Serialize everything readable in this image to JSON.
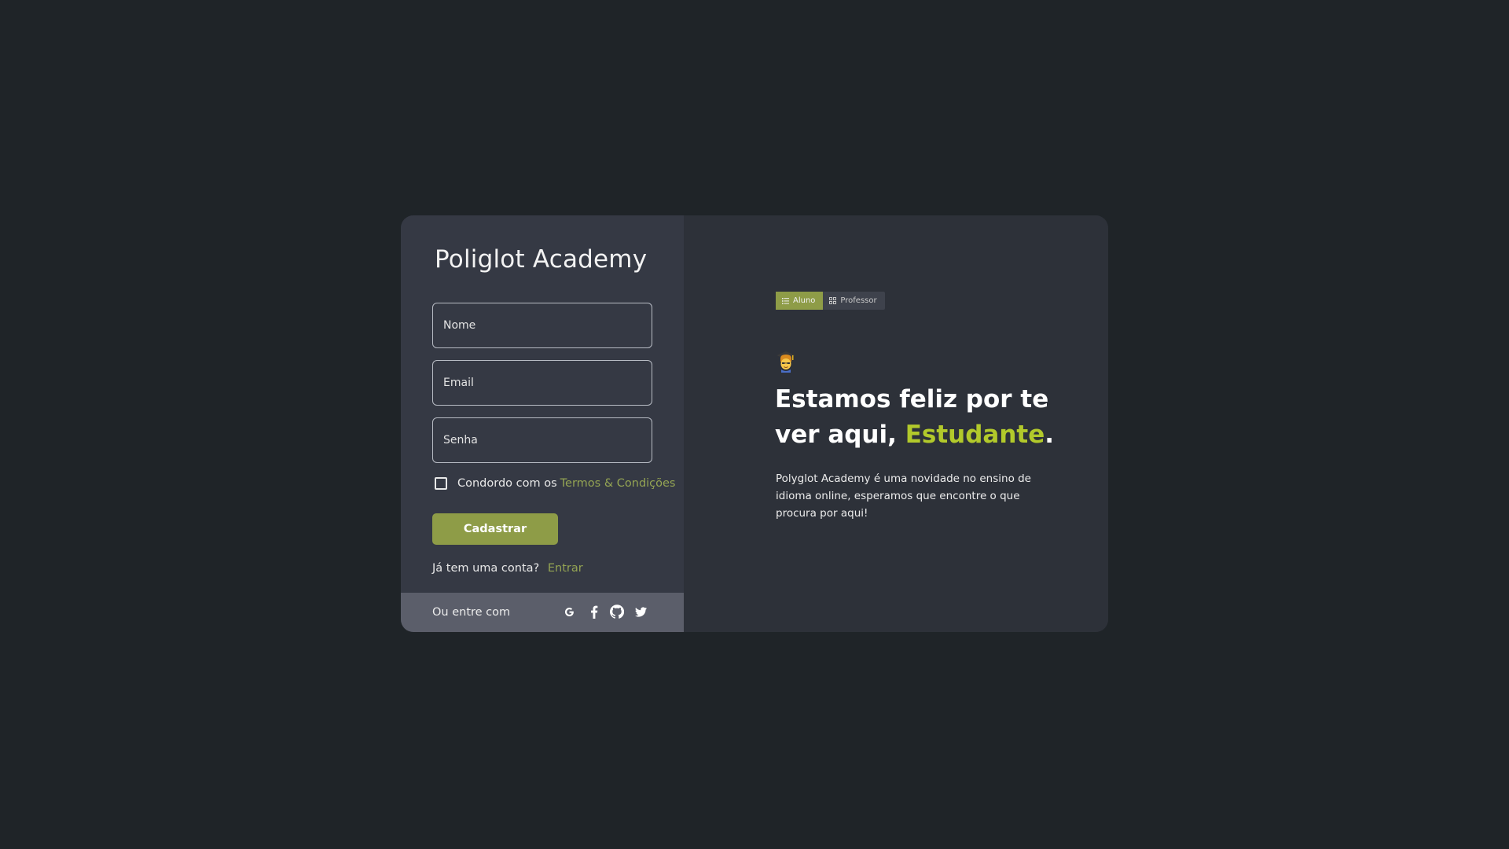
{
  "brand": {
    "title": "Poliglot Academy"
  },
  "form": {
    "name_placeholder": "Nome",
    "email_placeholder": "Email",
    "password_placeholder": "Senha",
    "terms_prefix": "Condordo com os",
    "terms_link": "Termos & Condições",
    "terms_checked": false,
    "submit_label": "Cadastrar",
    "account_question": "Já tem uma conta?",
    "login_link": "Entrar"
  },
  "social": {
    "label": "Ou entre com",
    "providers": [
      "google-icon",
      "facebook-icon",
      "github-icon",
      "twitter-icon"
    ]
  },
  "roles": {
    "options": [
      {
        "label": "Aluno",
        "icon": "list-icon",
        "active": true
      },
      {
        "label": "Professor",
        "icon": "grid-icon",
        "active": false
      }
    ]
  },
  "welcome": {
    "emoji": "student-emoji-icon",
    "headline_prefix": "Estamos feliz por te ver aqui, ",
    "headline_highlight": "Estudante",
    "headline_suffix": ".",
    "description": "Polyglot Academy é uma novidade no ensino  de idioma online, esperamos que encontre o que procura por aqui!"
  },
  "colors": {
    "background": "#1f2428",
    "panel_left": "#353944",
    "panel_right": "#2d3139",
    "accent": "#8e9c47",
    "highlight": "#b2c92b",
    "link": "#94a453"
  }
}
